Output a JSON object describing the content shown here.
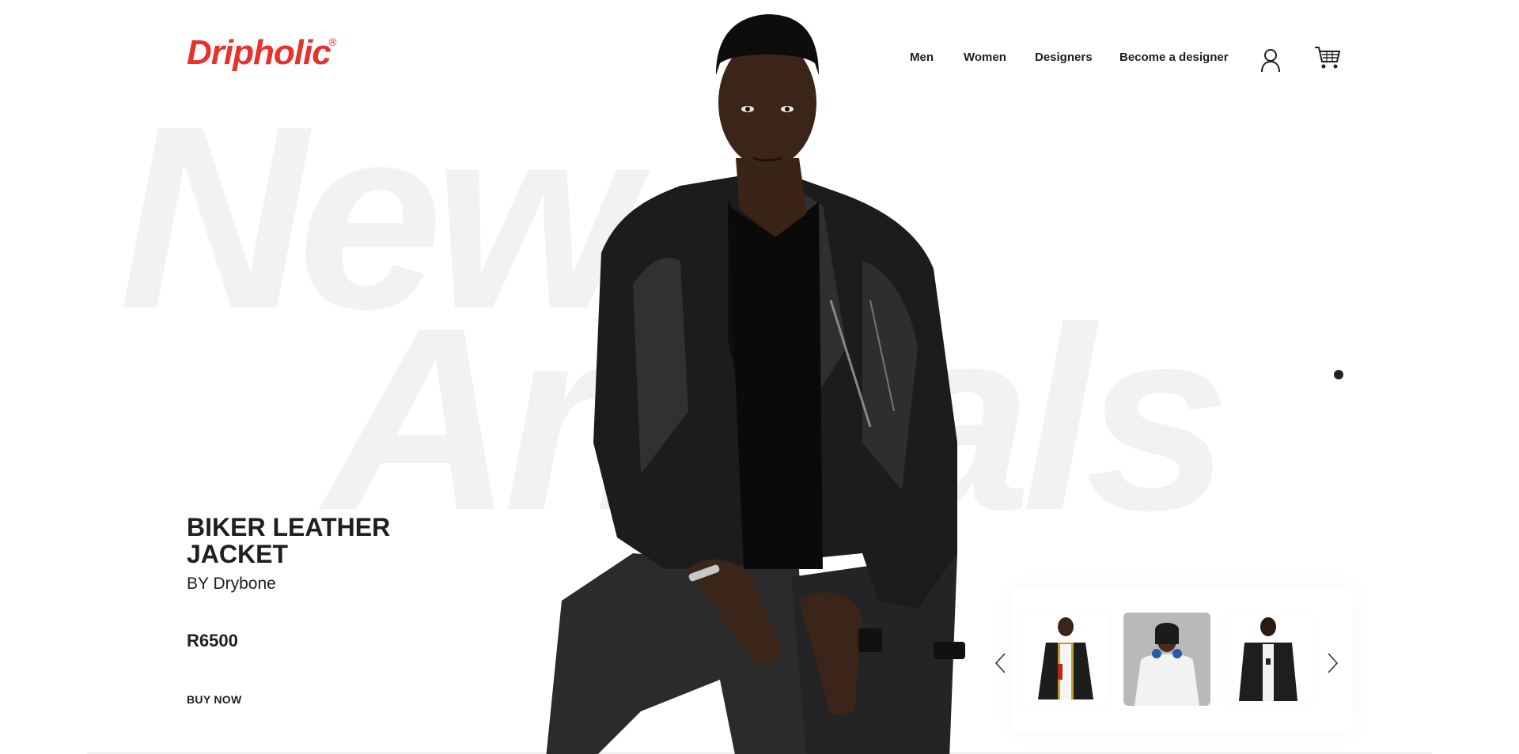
{
  "brand": {
    "logo_text": "Dripholic",
    "registered_mark": "®",
    "color": "#e8312b"
  },
  "nav": {
    "items": [
      {
        "label": "Men"
      },
      {
        "label": "Women"
      },
      {
        "label": "Designers"
      },
      {
        "label": "Become a designer"
      }
    ],
    "icons": [
      "user-icon",
      "cart-icon"
    ]
  },
  "hero": {
    "watermark_line1": "New",
    "watermark_line2": "Arrivals",
    "watermark_color": "#f2f2f2"
  },
  "product": {
    "title": "BIKER LEATHER JACKET",
    "by_line": "BY Drybone",
    "price": "R6500",
    "cta_label": "BUY NOW"
  },
  "carousel": {
    "thumbnails": [
      {
        "name": "thumbnail-embroidered-jacket",
        "bg": "#ffffff"
      },
      {
        "name": "thumbnail-white-hoodie",
        "bg": "#b9b9b9"
      },
      {
        "name": "thumbnail-black-denim-jacket",
        "bg": "#ffffff"
      }
    ],
    "prev_icon": "chevron-left-icon",
    "next_icon": "chevron-right-icon"
  },
  "slide_indicator": {
    "active_index": 0,
    "count": 1
  }
}
